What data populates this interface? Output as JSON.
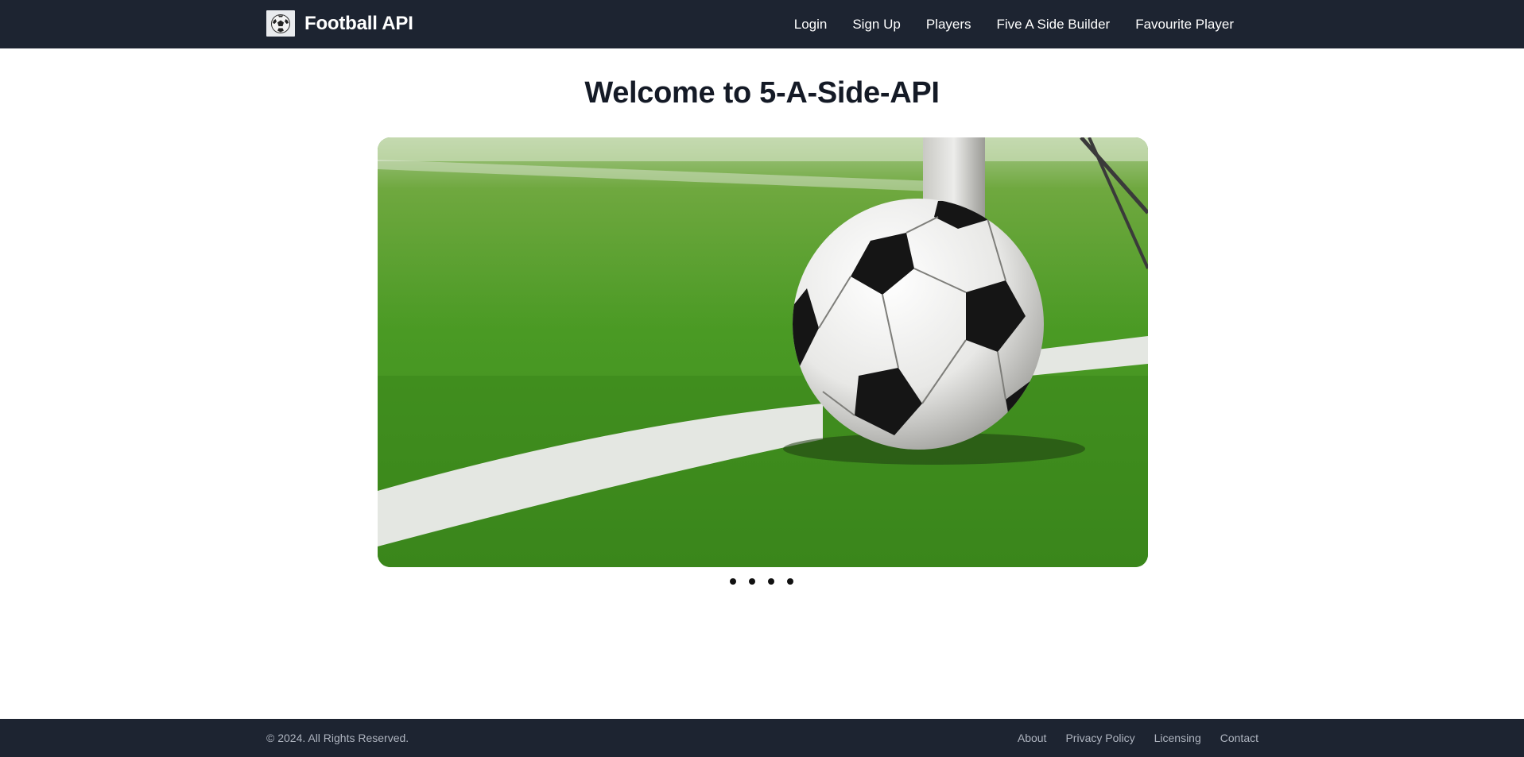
{
  "header": {
    "brand": "Football API",
    "logo_icon": "soccer-ball-icon",
    "nav": [
      "Login",
      "Sign Up",
      "Players",
      "Five A Side Builder",
      "Favourite Player"
    ]
  },
  "main": {
    "title": "Welcome to 5-A-Side-API",
    "carousel": {
      "image": "soccer-ball-on-grass-photo",
      "slide_count": 4,
      "active_slide": 1
    }
  },
  "footer": {
    "copyright": "© 2024. All Rights Reserved.",
    "links": [
      "About",
      "Privacy Policy",
      "Licensing",
      "Contact"
    ]
  },
  "colors": {
    "nav_background": "#1d2431",
    "title_text": "#141a26",
    "footer_text": "#aeb4bf"
  }
}
